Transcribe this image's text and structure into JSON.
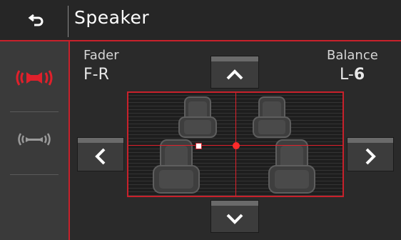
{
  "header": {
    "title": "Speaker"
  },
  "fader": {
    "label": "Fader",
    "value": "F-R"
  },
  "balance": {
    "label": "Balance",
    "value_prefix": "L-",
    "value_num": "6"
  },
  "sidebar": {
    "items": [
      {
        "name": "surround-speaker-icon",
        "active": true
      },
      {
        "name": "stereo-speaker-icon",
        "active": false
      }
    ]
  },
  "colors": {
    "accent": "#c8212b",
    "background": "#2a2a2a"
  }
}
